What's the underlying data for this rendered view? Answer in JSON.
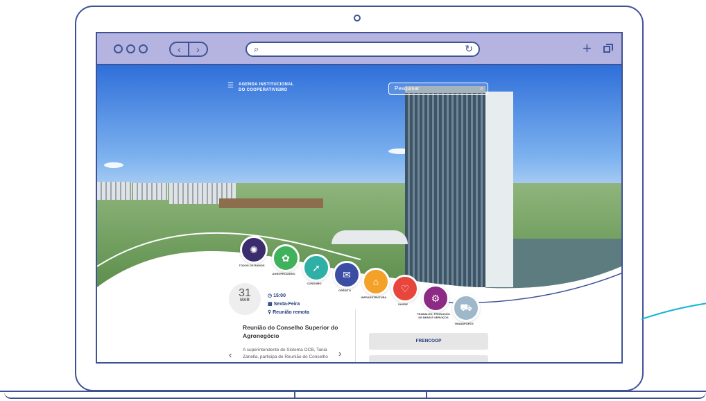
{
  "site": {
    "title_line1": "AGENDA INSTITUCIONAL",
    "title_line2": "DO COOPERATIVISMO",
    "search_placeholder": "Pesquisar"
  },
  "categories": [
    {
      "label": "TODOS OS RAMOS",
      "color": "#3b2c6e",
      "icon": "all-branches-icon"
    },
    {
      "label": "AGROPECUÁRIO",
      "color": "#3fb25b",
      "icon": "agro-icon"
    },
    {
      "label": "CONSUMO",
      "color": "#2fb0a6",
      "icon": "consumo-icon"
    },
    {
      "label": "CRÉDITO",
      "color": "#3c4ea3",
      "icon": "credito-icon"
    },
    {
      "label": "INFRAESTRUTURA",
      "color": "#f4a12a",
      "icon": "infra-icon"
    },
    {
      "label": "SAÚDE",
      "color": "#e8453c",
      "icon": "saude-icon"
    },
    {
      "label": "TRABALHO, PRODUÇÃO DE BENS E SERVIÇOS",
      "color": "#8c2a86",
      "icon": "trabalho-icon"
    },
    {
      "label": "TRANSPORTE",
      "color": "#9fb8c9",
      "icon": "transporte-icon"
    }
  ],
  "event": {
    "day": "31",
    "month": "MAR",
    "time": "15:00",
    "weekday": "Sexta-Feira",
    "location": "Reunião remota",
    "title": "Reunião do Conselho Superior do Agronegócio",
    "description": "A superintendente do Sistema OCB, Tania Zanella, participa de Reunião do Conselho"
  },
  "side_buttons": {
    "frencoop": "FRENCOOP"
  },
  "icons": {
    "menu": "hamburger-icon",
    "search": "search-icon",
    "reload": "reload-icon",
    "new_tab": "plus-icon",
    "tabs": "tabs-icon",
    "back": "chevron-left-icon",
    "forward": "chevron-right-icon"
  }
}
